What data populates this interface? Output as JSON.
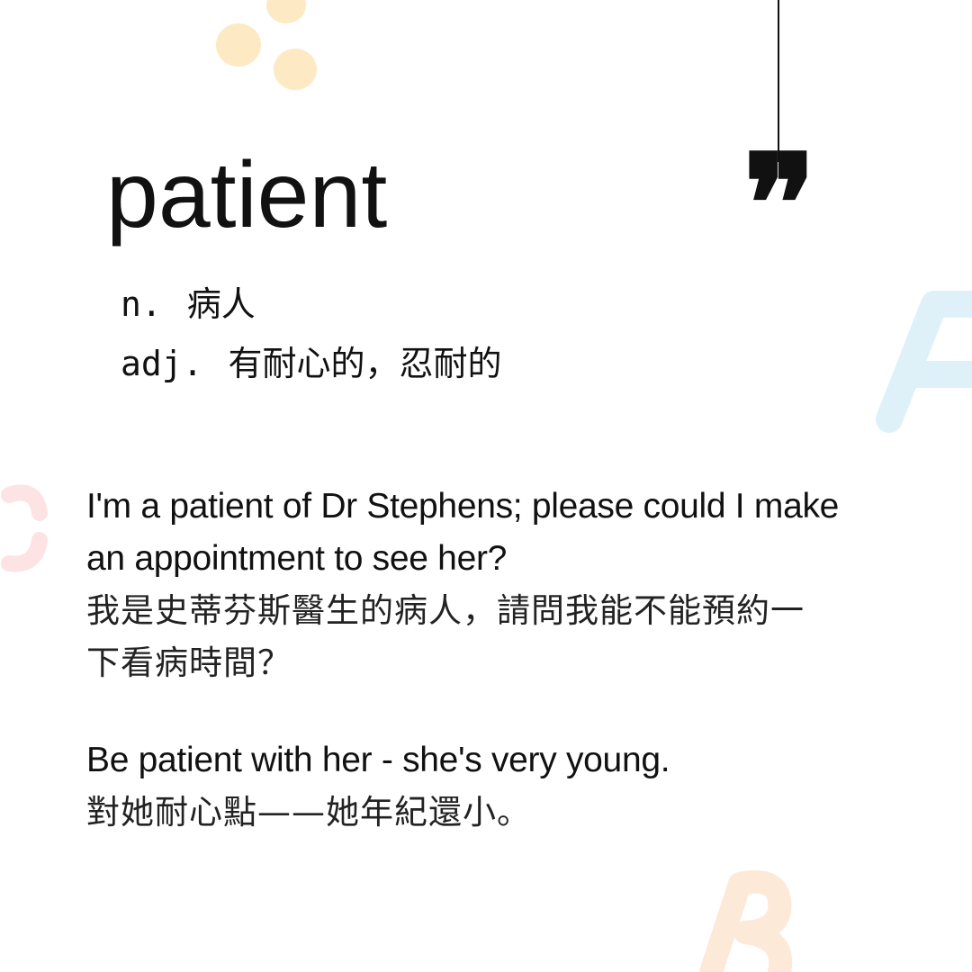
{
  "word": "patient",
  "definitions": [
    {
      "pos": "n.",
      "meaning": "病人"
    },
    {
      "pos": "adj.",
      "meaning": "有耐心的，忍耐的"
    }
  ],
  "examples": [
    {
      "en_lines": [
        "I'm a patient of Dr Stephens; please could I make",
        "an appointment to see her?"
      ],
      "zh_lines": [
        "我是史蒂芬斯醫生的病人，請問我能不能預約一",
        "下看病時間？"
      ]
    },
    {
      "en_lines": [
        "Be patient with her - she's very young."
      ],
      "zh_lines": [
        "對她耐心點——她年紀還小。"
      ]
    }
  ],
  "colors": {
    "text": "#111111",
    "dot": "#fde9c4",
    "letter_blue": "#dff1f8",
    "letter_pink": "#fde3e3",
    "letter_peach": "#fde9d8"
  }
}
